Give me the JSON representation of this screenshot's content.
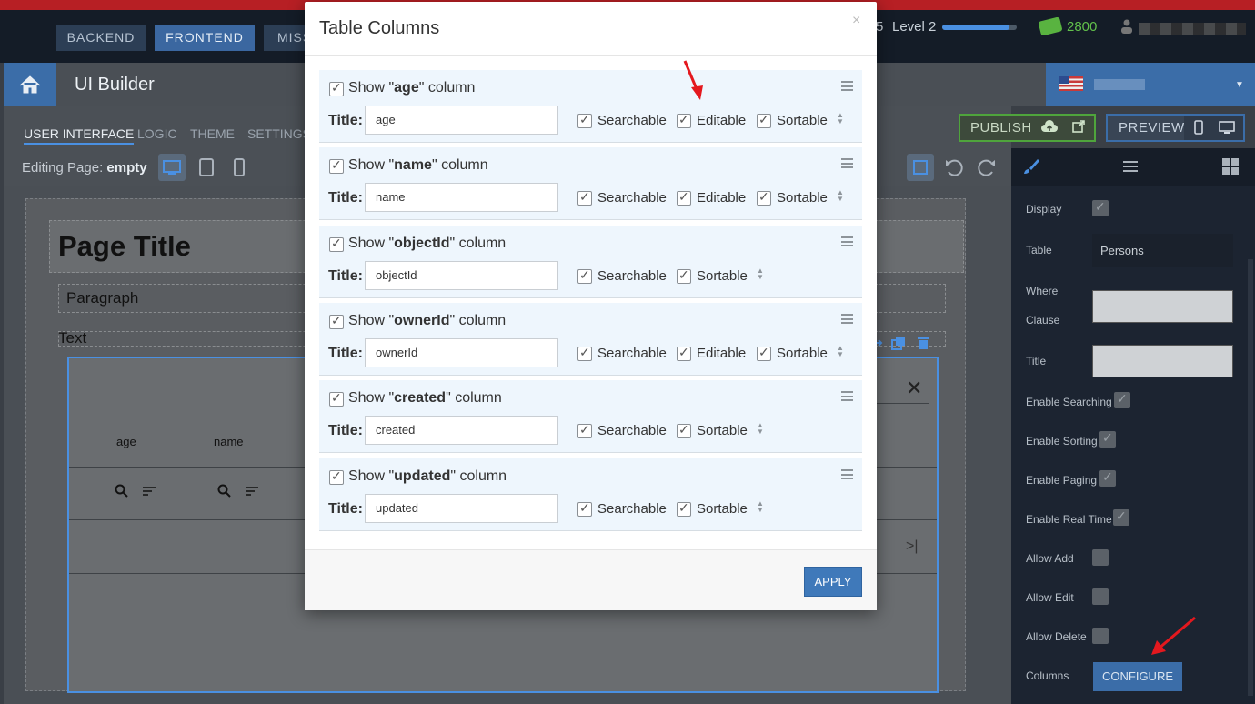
{
  "topnav": {
    "tabs": [
      {
        "label": "BACKEND"
      },
      {
        "label": "FRONTEND"
      },
      {
        "label": "MISS"
      }
    ],
    "level_num": "5",
    "level_label": "Level 2",
    "level_progress": 0.9,
    "coins": "2800"
  },
  "builder": {
    "title": "UI Builder",
    "subtabs": [
      "USER INTERFACE",
      "LOGIC",
      "THEME",
      "SETTINGS"
    ],
    "editing_prefix": "Editing Page:",
    "editing_page": "empty",
    "publish_label": "PUBLISH",
    "preview_label": "PREVIEW"
  },
  "canvas": {
    "page_title": "Page Title",
    "paragraph": "Paragraph",
    "text": "Text",
    "table_headers": [
      "age",
      "name"
    ],
    "close_glyph": "✕",
    "last_glyph": ">|"
  },
  "panel": {
    "display_label": "Display",
    "table_label": "Table",
    "table_value": "Persons",
    "where_label_1": "Where",
    "where_label_2": "Clause",
    "title_label": "Title",
    "enable_searching": "Enable Searching",
    "enable_sorting": "Enable Sorting",
    "enable_paging": "Enable Paging",
    "enable_realtime": "Enable Real Time",
    "allow_add": "Allow Add",
    "allow_edit": "Allow Edit",
    "allow_delete": "Allow Delete",
    "columns_label": "Columns",
    "configure_label": "CONFIGURE"
  },
  "modal": {
    "title": "Table Columns",
    "close": "×",
    "show_prefix": "Show \"",
    "show_suffix": "\" column",
    "title_label": "Title:",
    "searchable": "Searchable",
    "editable": "Editable",
    "sortable": "Sortable",
    "apply": "APPLY",
    "columns": [
      {
        "name": "age",
        "title": "age",
        "editable": true
      },
      {
        "name": "name",
        "title": "name",
        "editable": true
      },
      {
        "name": "objectId",
        "title": "objectId",
        "editable": false
      },
      {
        "name": "ownerId",
        "title": "ownerId",
        "editable": true
      },
      {
        "name": "created",
        "title": "created",
        "editable": false
      },
      {
        "name": "updated",
        "title": "updated",
        "editable": false
      }
    ]
  },
  "colors": {
    "accent": "#3b6da8",
    "publish_green": "#4fa43c",
    "alert_red": "#e4181e"
  }
}
